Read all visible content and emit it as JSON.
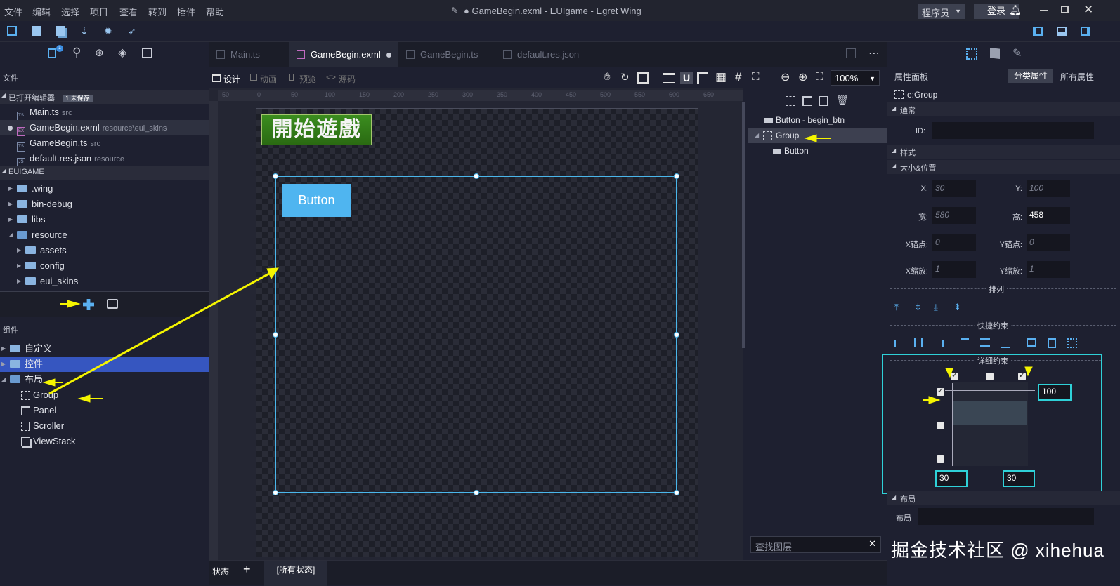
{
  "menu": [
    "文件",
    "编辑",
    "选择",
    "项目",
    "查看",
    "转到",
    "插件",
    "帮助"
  ],
  "window_title": "● GameBegin.exml - EUIgame - Egret Wing",
  "role": "程序员",
  "login": "登录",
  "left": {
    "files_header": "文件",
    "open_editors": "已打开编辑器",
    "unsaved_badge": "1 未保存",
    "open_files": [
      {
        "name": "Main.ts",
        "path": "src"
      },
      {
        "name": "GameBegin.exml",
        "path": "resource\\eui_skins"
      },
      {
        "name": "GameBegin.ts",
        "path": "src"
      },
      {
        "name": "default.res.json",
        "path": "resource"
      }
    ],
    "project_header": "EUIGAME",
    "tree": [
      ".wing",
      "bin-debug",
      "libs",
      "resource",
      "assets",
      "config",
      "eui_skins"
    ],
    "components_header": "组件",
    "comp_tree": [
      "自定义",
      "控件",
      "布局"
    ],
    "layout_items": [
      "Group",
      "Panel",
      "Scroller",
      "ViewStack"
    ]
  },
  "tabs": [
    "Main.ts",
    "GameBegin.exml",
    "GameBegin.ts",
    "default.res.json"
  ],
  "design_modes": [
    "设计",
    "动画",
    "预览",
    "源码"
  ],
  "zoom": "100%",
  "ruler_labels": [
    "50",
    "0",
    "50",
    "100",
    "150",
    "200",
    "250",
    "300",
    "350",
    "400",
    "450",
    "500",
    "550",
    "600",
    "650"
  ],
  "canvas": {
    "begin_label": "開始遊戲",
    "button_label": "Button"
  },
  "layers": {
    "items": [
      "Button - begin_btn",
      "Group",
      "Button"
    ],
    "search_placeholder": "查找图层"
  },
  "status": {
    "label": "状态",
    "all_states": "[所有状态]"
  },
  "props": {
    "title": "属性面板",
    "tab_category": "分类属性",
    "tab_all": "所有属性",
    "element": "e:Group",
    "sec_common": "通常",
    "id_label": "ID:",
    "sec_style": "样式",
    "sec_size": "大小&位置",
    "x_label": "X:",
    "x_val": "30",
    "y_label": "Y:",
    "y_val": "100",
    "w_label": "宽:",
    "w_val": "580",
    "h_label": "高:",
    "h_val": "458",
    "ax_label": "X锚点:",
    "ax_val": "0",
    "ay_label": "Y锚点:",
    "ay_val": "0",
    "sx_label": "X缩放:",
    "sx_val": "1",
    "sy_label": "Y缩放:",
    "sy_val": "1",
    "arrange": "排列",
    "quick": "快捷约束",
    "detail": "详细约束",
    "c_right": "100",
    "c_bottom_left": "30",
    "c_bottom_right": "30",
    "sec_layout": "布局",
    "layout_label": "布局"
  },
  "watermark": "掘金技术社区 @ xihehua"
}
